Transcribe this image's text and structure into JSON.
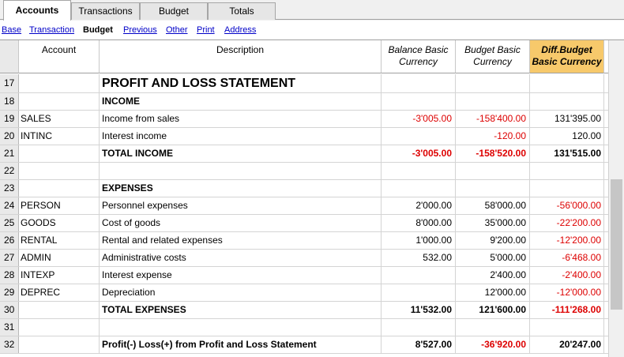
{
  "tabs": [
    {
      "label": "Accounts",
      "active": true
    },
    {
      "label": "Transactions",
      "active": false
    },
    {
      "label": "Budget",
      "active": false
    },
    {
      "label": "Totals",
      "active": false
    }
  ],
  "views": [
    {
      "label": "Base",
      "current": false
    },
    {
      "label": "Transaction",
      "current": false
    },
    {
      "label": "Budget",
      "current": true
    },
    {
      "label": "Previous",
      "current": false
    },
    {
      "label": "Other",
      "current": false
    },
    {
      "label": "Print",
      "current": false
    },
    {
      "label": "Address",
      "current": false
    }
  ],
  "columns": {
    "account": "Account",
    "description": "Description",
    "balance_line1": "Balance Basic",
    "balance_line2": "Currency",
    "budget_line1": "Budget Basic",
    "budget_line2": "Currency",
    "diff_line1": "Diff.Budget",
    "diff_line2": "Basic Currency"
  },
  "colors": {
    "highlight_header": "#f7c96b",
    "negative": "#dd0000",
    "link": "#0000c8"
  },
  "rows": [
    {
      "num": "17",
      "account": "",
      "description": "PROFIT AND LOSS STATEMENT",
      "balance": "",
      "budget": "",
      "diff": "",
      "style": "title"
    },
    {
      "num": "18",
      "account": "",
      "description": "INCOME",
      "balance": "",
      "budget": "",
      "diff": "",
      "style": "bold"
    },
    {
      "num": "19",
      "account": "SALES",
      "description": "Income from sales",
      "balance": "-3'005.00",
      "budget": "-158'400.00",
      "diff": "131'395.00",
      "style": ""
    },
    {
      "num": "20",
      "account": "INTINC",
      "description": "Interest income",
      "balance": "",
      "budget": "-120.00",
      "diff": "120.00",
      "style": ""
    },
    {
      "num": "21",
      "account": "",
      "description": "TOTAL INCOME",
      "balance": "-3'005.00",
      "budget": "-158'520.00",
      "diff": "131'515.00",
      "style": "bold"
    },
    {
      "num": "22",
      "account": "",
      "description": "",
      "balance": "",
      "budget": "",
      "diff": "",
      "style": ""
    },
    {
      "num": "23",
      "account": "",
      "description": "EXPENSES",
      "balance": "",
      "budget": "",
      "diff": "",
      "style": "bold"
    },
    {
      "num": "24",
      "account": "PERSON",
      "description": "Personnel expenses",
      "balance": "2'000.00",
      "budget": "58'000.00",
      "diff": "-56'000.00",
      "style": ""
    },
    {
      "num": "25",
      "account": "GOODS",
      "description": "Cost of goods",
      "balance": "8'000.00",
      "budget": "35'000.00",
      "diff": "-22'200.00",
      "style": ""
    },
    {
      "num": "26",
      "account": "RENTAL",
      "description": "Rental and related expenses",
      "balance": "1'000.00",
      "budget": "9'200.00",
      "diff": "-12'200.00",
      "style": ""
    },
    {
      "num": "27",
      "account": "ADMIN",
      "description": "Administrative costs",
      "balance": "532.00",
      "budget": "5'000.00",
      "diff": "-6'468.00",
      "style": ""
    },
    {
      "num": "28",
      "account": "INTEXP",
      "description": "Interest expense",
      "balance": "",
      "budget": "2'400.00",
      "diff": "-2'400.00",
      "style": ""
    },
    {
      "num": "29",
      "account": "DEPREC",
      "description": "Depreciation",
      "balance": "",
      "budget": "12'000.00",
      "diff": "-12'000.00",
      "style": ""
    },
    {
      "num": "30",
      "account": "",
      "description": "TOTAL EXPENSES",
      "balance": "11'532.00",
      "budget": "121'600.00",
      "diff": "-111'268.00",
      "style": "bold"
    },
    {
      "num": "31",
      "account": "",
      "description": "",
      "balance": "",
      "budget": "",
      "diff": "",
      "style": ""
    },
    {
      "num": "32",
      "account": "",
      "description": "Profit(-) Loss(+) from Profit and Loss Statement",
      "balance": "8'527.00",
      "budget": "-36'920.00",
      "diff": "20'247.00",
      "style": "bold"
    }
  ]
}
